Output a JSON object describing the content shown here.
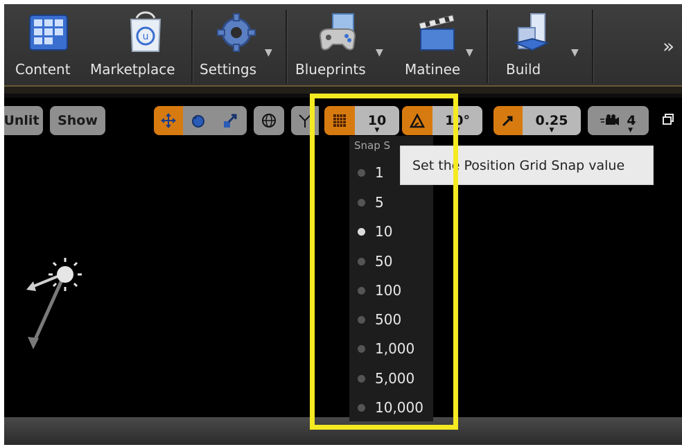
{
  "toolbar": {
    "items": [
      {
        "label": "Content",
        "icon": "content-icon"
      },
      {
        "label": "Marketplace",
        "icon": "marketplace-icon"
      },
      {
        "label": "Settings",
        "icon": "settings-gear-icon"
      },
      {
        "label": "Blueprints",
        "icon": "blueprints-gamepad-icon"
      },
      {
        "label": "Matinee",
        "icon": "matinee-clapper-icon"
      },
      {
        "label": "Build",
        "icon": "build-blocks-icon"
      }
    ],
    "more": "»"
  },
  "viewport": {
    "unlit_label": "Unlit",
    "show_label": "Show",
    "grid_snap_value": "10",
    "rotation_snap_value": "10°",
    "scale_snap_value": "0.25",
    "camera_speed_value": "4"
  },
  "snap_dropdown": {
    "header": "Snap Sizes",
    "header_visible": "Snap S",
    "options": [
      "1",
      "5",
      "10",
      "50",
      "100",
      "500",
      "1,000",
      "5,000",
      "10,000"
    ],
    "selected": "10"
  },
  "tooltip": {
    "text": "Set the Position Grid Snap value"
  },
  "colors": {
    "accent_orange": "#d77b10",
    "highlight_yellow": "#f5ea22",
    "toolbar_bg": "#383838",
    "viewport_bg": "#000000"
  }
}
